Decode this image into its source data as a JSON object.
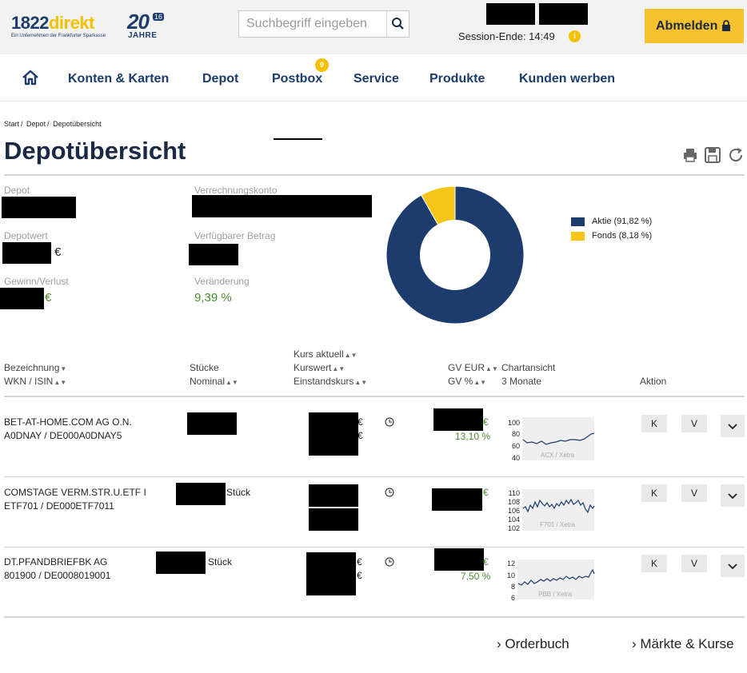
{
  "header": {
    "logo_number": "1822",
    "logo_word": "direkt",
    "logo_tagline": "Ein Unternehmen der Frankfurter Sparkasse",
    "anniversary_number": "20",
    "anniversary_badge": "16",
    "anniversary_word": "JAHRE",
    "search_placeholder": "Suchbegriff eingeben",
    "session_label": "Session-Ende: 14:49",
    "logout_label": "Abmelden",
    "accent_color": "#f8c12e",
    "brand_color": "#1b3c6c"
  },
  "nav": {
    "items": [
      "Konten & Karten",
      "Depot",
      "Postbox",
      "Service",
      "Produkte",
      "Kunden werben"
    ],
    "postbox_badge": "9"
  },
  "breadcrumb": [
    "Start",
    "Depot",
    "Depotübersicht"
  ],
  "page_title": "Depotübersicht",
  "summary": {
    "depot_label": "Depot",
    "verrechnungskonto_label": "Verrechnungskonto",
    "depotwert_label": "Depotwert",
    "depotwert_currency": "€",
    "verfuegbar_label": "Verfügbarer Betrag",
    "gewinn_label": "Gewinn/Verlust",
    "gewinn_currency": "€",
    "veraenderung_label": "Veränderung",
    "veraenderung_value": "9,39 %"
  },
  "allocation": {
    "legend": [
      {
        "label": "Aktie (91,82 %)",
        "color": "#1b3c6c",
        "share": 91.82
      },
      {
        "label": "Fonds (8,18 %)",
        "color": "#f5c518",
        "share": 8.18
      }
    ]
  },
  "table": {
    "headers": {
      "bezeichnung": "Bezeichnung",
      "wkn_isin": "WKN / ISIN",
      "stuecke": "Stücke",
      "nominal": "Nominal",
      "kurs_aktuell": "Kurs aktuell",
      "kurswert": "Kurswert",
      "einstandskurs": "Einstandskurs",
      "gv_eur": "GV EUR",
      "gv_pct": "GV %",
      "chartansicht": "Chartansicht",
      "monate": "3 Monate",
      "aktion": "Aktion"
    },
    "buy_label": "K",
    "sell_label": "V",
    "rows": [
      {
        "name": "BET-AT-HOME.COM AG O.N.",
        "wkn_isin": "A0DNAY / DE000A0DNAY5",
        "stueck_label": "",
        "gv_pct": "13,10 %",
        "chart_label": "ACX / Xetra",
        "y_ticks": [
          "100",
          "80",
          "60",
          "40"
        ]
      },
      {
        "name": "COMSTAGE VERM.STR.U.ETF I",
        "wkn_isin": "ETF701 / DE000ETF7011",
        "stueck_label": "Stück",
        "gv_pct": "",
        "chart_label": "F701 / Xetra",
        "y_ticks": [
          "110",
          "108",
          "106",
          "104",
          "102"
        ]
      },
      {
        "name": "DT.PFANDBRIEFBK AG",
        "wkn_isin": "801900 / DE0008019001",
        "stueck_label": "Stück",
        "gv_pct": "7,50 %",
        "chart_label": "PBB / Xetra",
        "y_ticks": [
          "12",
          "10",
          "8",
          "6"
        ]
      }
    ]
  },
  "footer": {
    "orderbuch": "Orderbuch",
    "maerkte": "Märkte & Kurse"
  }
}
